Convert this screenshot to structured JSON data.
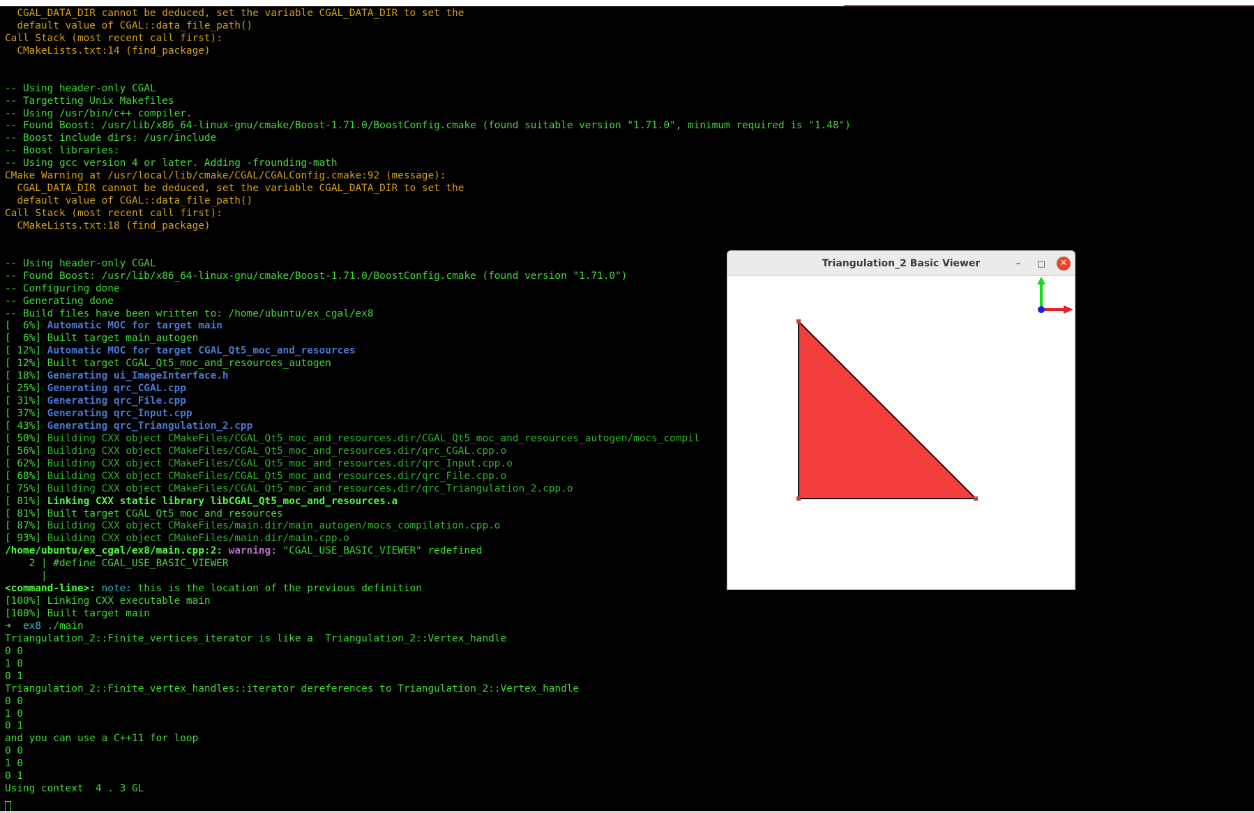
{
  "terminal": {
    "lines": [
      {
        "segments": [
          {
            "text": "  CGAL_DATA_DIR cannot be deduced, set the variable CGAL_DATA_DIR to set the",
            "class": "c-orange"
          }
        ]
      },
      {
        "segments": [
          {
            "text": "  default value of CGAL::data_file_path()",
            "class": "c-orange"
          }
        ]
      },
      {
        "segments": [
          {
            "text": "Call Stack (most recent call first):",
            "class": "c-orange"
          }
        ]
      },
      {
        "segments": [
          {
            "text": "  CMakeLists.txt:14 (find_package)",
            "class": "c-orange"
          }
        ]
      },
      {
        "segments": [
          {
            "text": "",
            "class": "c-orange"
          }
        ]
      },
      {
        "segments": [
          {
            "text": "",
            "class": "c-orange"
          }
        ]
      },
      {
        "segments": [
          {
            "text": "-- Using header-only CGAL",
            "class": "c-green"
          }
        ]
      },
      {
        "segments": [
          {
            "text": "-- Targetting Unix Makefiles",
            "class": "c-green"
          }
        ]
      },
      {
        "segments": [
          {
            "text": "-- Using /usr/bin/c++ compiler.",
            "class": "c-green"
          }
        ]
      },
      {
        "segments": [
          {
            "text": "-- Found Boost: /usr/lib/x86_64-linux-gnu/cmake/Boost-1.71.0/BoostConfig.cmake (found suitable version \"1.71.0\", minimum required is \"1.48\")",
            "class": "c-green"
          }
        ]
      },
      {
        "segments": [
          {
            "text": "-- Boost include dirs: /usr/include",
            "class": "c-green"
          }
        ]
      },
      {
        "segments": [
          {
            "text": "-- Boost libraries:",
            "class": "c-green"
          }
        ]
      },
      {
        "segments": [
          {
            "text": "-- Using gcc version 4 or later. Adding -frounding-math",
            "class": "c-green"
          }
        ]
      },
      {
        "segments": [
          {
            "text": "CMake Warning at /usr/local/lib/cmake/CGAL/CGALConfig.cmake:92 (message):",
            "class": "c-orange"
          }
        ]
      },
      {
        "segments": [
          {
            "text": "  CGAL_DATA_DIR cannot be deduced, set the variable CGAL_DATA_DIR to set the",
            "class": "c-orange"
          }
        ]
      },
      {
        "segments": [
          {
            "text": "  default value of CGAL::data_file_path()",
            "class": "c-orange"
          }
        ]
      },
      {
        "segments": [
          {
            "text": "Call Stack (most recent call first):",
            "class": "c-orange"
          }
        ]
      },
      {
        "segments": [
          {
            "text": "  CMakeLists.txt:18 (find_package)",
            "class": "c-orange"
          }
        ]
      },
      {
        "segments": [
          {
            "text": "",
            "class": "c-orange"
          }
        ]
      },
      {
        "segments": [
          {
            "text": "",
            "class": "c-orange"
          }
        ]
      },
      {
        "segments": [
          {
            "text": "-- Using header-only CGAL",
            "class": "c-green"
          }
        ]
      },
      {
        "segments": [
          {
            "text": "-- Found Boost: /usr/lib/x86_64-linux-gnu/cmake/Boost-1.71.0/BoostConfig.cmake (found version \"1.71.0\")",
            "class": "c-green"
          }
        ]
      },
      {
        "segments": [
          {
            "text": "-- Configuring done",
            "class": "c-green"
          }
        ]
      },
      {
        "segments": [
          {
            "text": "-- Generating done",
            "class": "c-green"
          }
        ]
      },
      {
        "segments": [
          {
            "text": "-- Build files have been written to: /home/ubuntu/ex_cgal/ex8",
            "class": "c-green"
          }
        ]
      },
      {
        "segments": [
          {
            "text": "[  6%] ",
            "class": "c-green"
          },
          {
            "text": "Automatic MOC for target main",
            "class": "c-blue"
          }
        ]
      },
      {
        "segments": [
          {
            "text": "[  6%] Built target main_autogen",
            "class": "c-green"
          }
        ]
      },
      {
        "segments": [
          {
            "text": "[ 12%] ",
            "class": "c-green"
          },
          {
            "text": "Automatic MOC for target CGAL_Qt5_moc_and_resources",
            "class": "c-blue"
          }
        ]
      },
      {
        "segments": [
          {
            "text": "[ 12%] Built target CGAL_Qt5_moc_and_resources_autogen",
            "class": "c-green"
          }
        ]
      },
      {
        "segments": [
          {
            "text": "[ 18%] ",
            "class": "c-green"
          },
          {
            "text": "Generating ui_ImageInterface.h",
            "class": "c-blue"
          }
        ]
      },
      {
        "segments": [
          {
            "text": "[ 25%] ",
            "class": "c-green"
          },
          {
            "text": "Generating qrc_CGAL.cpp",
            "class": "c-blue"
          }
        ]
      },
      {
        "segments": [
          {
            "text": "[ 31%] ",
            "class": "c-green"
          },
          {
            "text": "Generating qrc_File.cpp",
            "class": "c-blue"
          }
        ]
      },
      {
        "segments": [
          {
            "text": "[ 37%] ",
            "class": "c-green"
          },
          {
            "text": "Generating qrc_Input.cpp",
            "class": "c-blue"
          }
        ]
      },
      {
        "segments": [
          {
            "text": "[ 43%] ",
            "class": "c-green"
          },
          {
            "text": "Generating qrc_Triangulation_2.cpp",
            "class": "c-blue"
          }
        ]
      },
      {
        "segments": [
          {
            "text": "[ 50%] ",
            "class": "c-green"
          },
          {
            "text": "Building CXX object CMakeFiles/CGAL_Qt5_moc_and_resources.dir/CGAL_Qt5_moc_and_resources_autogen/mocs_compil",
            "class": "c-dkgreen"
          }
        ]
      },
      {
        "segments": [
          {
            "text": "[ 56%] ",
            "class": "c-green"
          },
          {
            "text": "Building CXX object CMakeFiles/CGAL_Qt5_moc_and_resources.dir/qrc_CGAL.cpp.o",
            "class": "c-dkgreen"
          }
        ]
      },
      {
        "segments": [
          {
            "text": "[ 62%] ",
            "class": "c-green"
          },
          {
            "text": "Building CXX object CMakeFiles/CGAL_Qt5_moc_and_resources.dir/qrc_Input.cpp.o",
            "class": "c-dkgreen"
          }
        ]
      },
      {
        "segments": [
          {
            "text": "[ 68%] ",
            "class": "c-green"
          },
          {
            "text": "Building CXX object CMakeFiles/CGAL_Qt5_moc_and_resources.dir/qrc_File.cpp.o",
            "class": "c-dkgreen"
          }
        ]
      },
      {
        "segments": [
          {
            "text": "[ 75%] ",
            "class": "c-green"
          },
          {
            "text": "Building CXX object CMakeFiles/CGAL_Qt5_moc_and_resources.dir/qrc_Triangulation_2.cpp.o",
            "class": "c-dkgreen"
          }
        ]
      },
      {
        "segments": [
          {
            "text": "[ 81%] ",
            "class": "c-green"
          },
          {
            "text": "Linking CXX static library libCGAL_Qt5_moc_and_resources.a",
            "class": "c-brightgreen"
          }
        ]
      },
      {
        "segments": [
          {
            "text": "[ 81%] Built target CGAL_Qt5_moc_and_resources",
            "class": "c-green"
          }
        ]
      },
      {
        "segments": [
          {
            "text": "[ 87%] ",
            "class": "c-green"
          },
          {
            "text": "Building CXX object CMakeFiles/main.dir/main_autogen/mocs_compilation.cpp.o",
            "class": "c-dkgreen"
          }
        ]
      },
      {
        "segments": [
          {
            "text": "[ 93%] ",
            "class": "c-green"
          },
          {
            "text": "Building CXX object CMakeFiles/main.dir/main.cpp.o",
            "class": "c-dkgreen"
          }
        ]
      },
      {
        "segments": [
          {
            "text": "/home/ubuntu/ex_cgal/ex8/main.cpp:2:",
            "class": "c-brightgreen"
          },
          {
            "text": " ",
            "class": "c-green"
          },
          {
            "text": "warning:",
            "class": "c-magenta"
          },
          {
            "text": " \"CGAL_USE_BASIC_VIEWER\" redefined",
            "class": "c-green"
          }
        ]
      },
      {
        "segments": [
          {
            "text": "    2 | #define CGAL_USE_BASIC_VIEWER",
            "class": "c-green"
          }
        ]
      },
      {
        "segments": [
          {
            "text": "      |",
            "class": "c-green"
          }
        ]
      },
      {
        "segments": [
          {
            "text": "<command-line>:",
            "class": "c-brightgreen"
          },
          {
            "text": " ",
            "class": "c-green"
          },
          {
            "text": "note:",
            "class": "c-cyan"
          },
          {
            "text": " this is the location of the previous definition",
            "class": "c-green"
          }
        ]
      },
      {
        "segments": [
          {
            "text": "[100%] ",
            "class": "c-green"
          },
          {
            "text": "Linking CXX executable main",
            "class": "c-green"
          }
        ]
      },
      {
        "segments": [
          {
            "text": "[100%] Built target main",
            "class": "c-green"
          }
        ]
      },
      {
        "segments": [
          {
            "text": "➜  ",
            "class": "c-green"
          },
          {
            "text": "ex8",
            "class": "c-cyan"
          },
          {
            "text": " ./main",
            "class": "c-green"
          }
        ]
      },
      {
        "segments": [
          {
            "text": "Triangulation_2::Finite_vertices_iterator is like a  Triangulation_2::Vertex_handle",
            "class": "c-green"
          }
        ]
      },
      {
        "segments": [
          {
            "text": "0 0",
            "class": "c-green"
          }
        ]
      },
      {
        "segments": [
          {
            "text": "1 0",
            "class": "c-green"
          }
        ]
      },
      {
        "segments": [
          {
            "text": "0 1",
            "class": "c-green"
          }
        ]
      },
      {
        "segments": [
          {
            "text": "Triangulation_2::Finite_vertex_handles::iterator dereferences to Triangulation_2::Vertex_handle",
            "class": "c-green"
          }
        ]
      },
      {
        "segments": [
          {
            "text": "0 0",
            "class": "c-green"
          }
        ]
      },
      {
        "segments": [
          {
            "text": "1 0",
            "class": "c-green"
          }
        ]
      },
      {
        "segments": [
          {
            "text": "0 1",
            "class": "c-green"
          }
        ]
      },
      {
        "segments": [
          {
            "text": "and you can use a C++11 for loop",
            "class": "c-green"
          }
        ]
      },
      {
        "segments": [
          {
            "text": "0 0",
            "class": "c-green"
          }
        ]
      },
      {
        "segments": [
          {
            "text": "1 0",
            "class": "c-green"
          }
        ]
      },
      {
        "segments": [
          {
            "text": "0 1",
            "class": "c-green"
          }
        ]
      },
      {
        "segments": [
          {
            "text": "Using context  4 . 3 GL",
            "class": "c-green"
          }
        ]
      }
    ]
  },
  "viewer": {
    "title": "Triangulation_2 Basic Viewer",
    "minimize_glyph": "–",
    "maximize_glyph": "□",
    "close_glyph": "✕",
    "triangle_fill": "#f43e3b",
    "edge_color": "#111111",
    "vertex_color": "#d03a3a",
    "axis_colors": {
      "x": "#e62020",
      "y": "#1ad91a",
      "z": "#1a1ad9"
    },
    "vertices": [
      [
        0,
        0
      ],
      [
        1,
        0
      ],
      [
        0,
        1
      ]
    ]
  },
  "colors": {
    "terminal_background": "#000000",
    "accent": "#e4482c"
  }
}
